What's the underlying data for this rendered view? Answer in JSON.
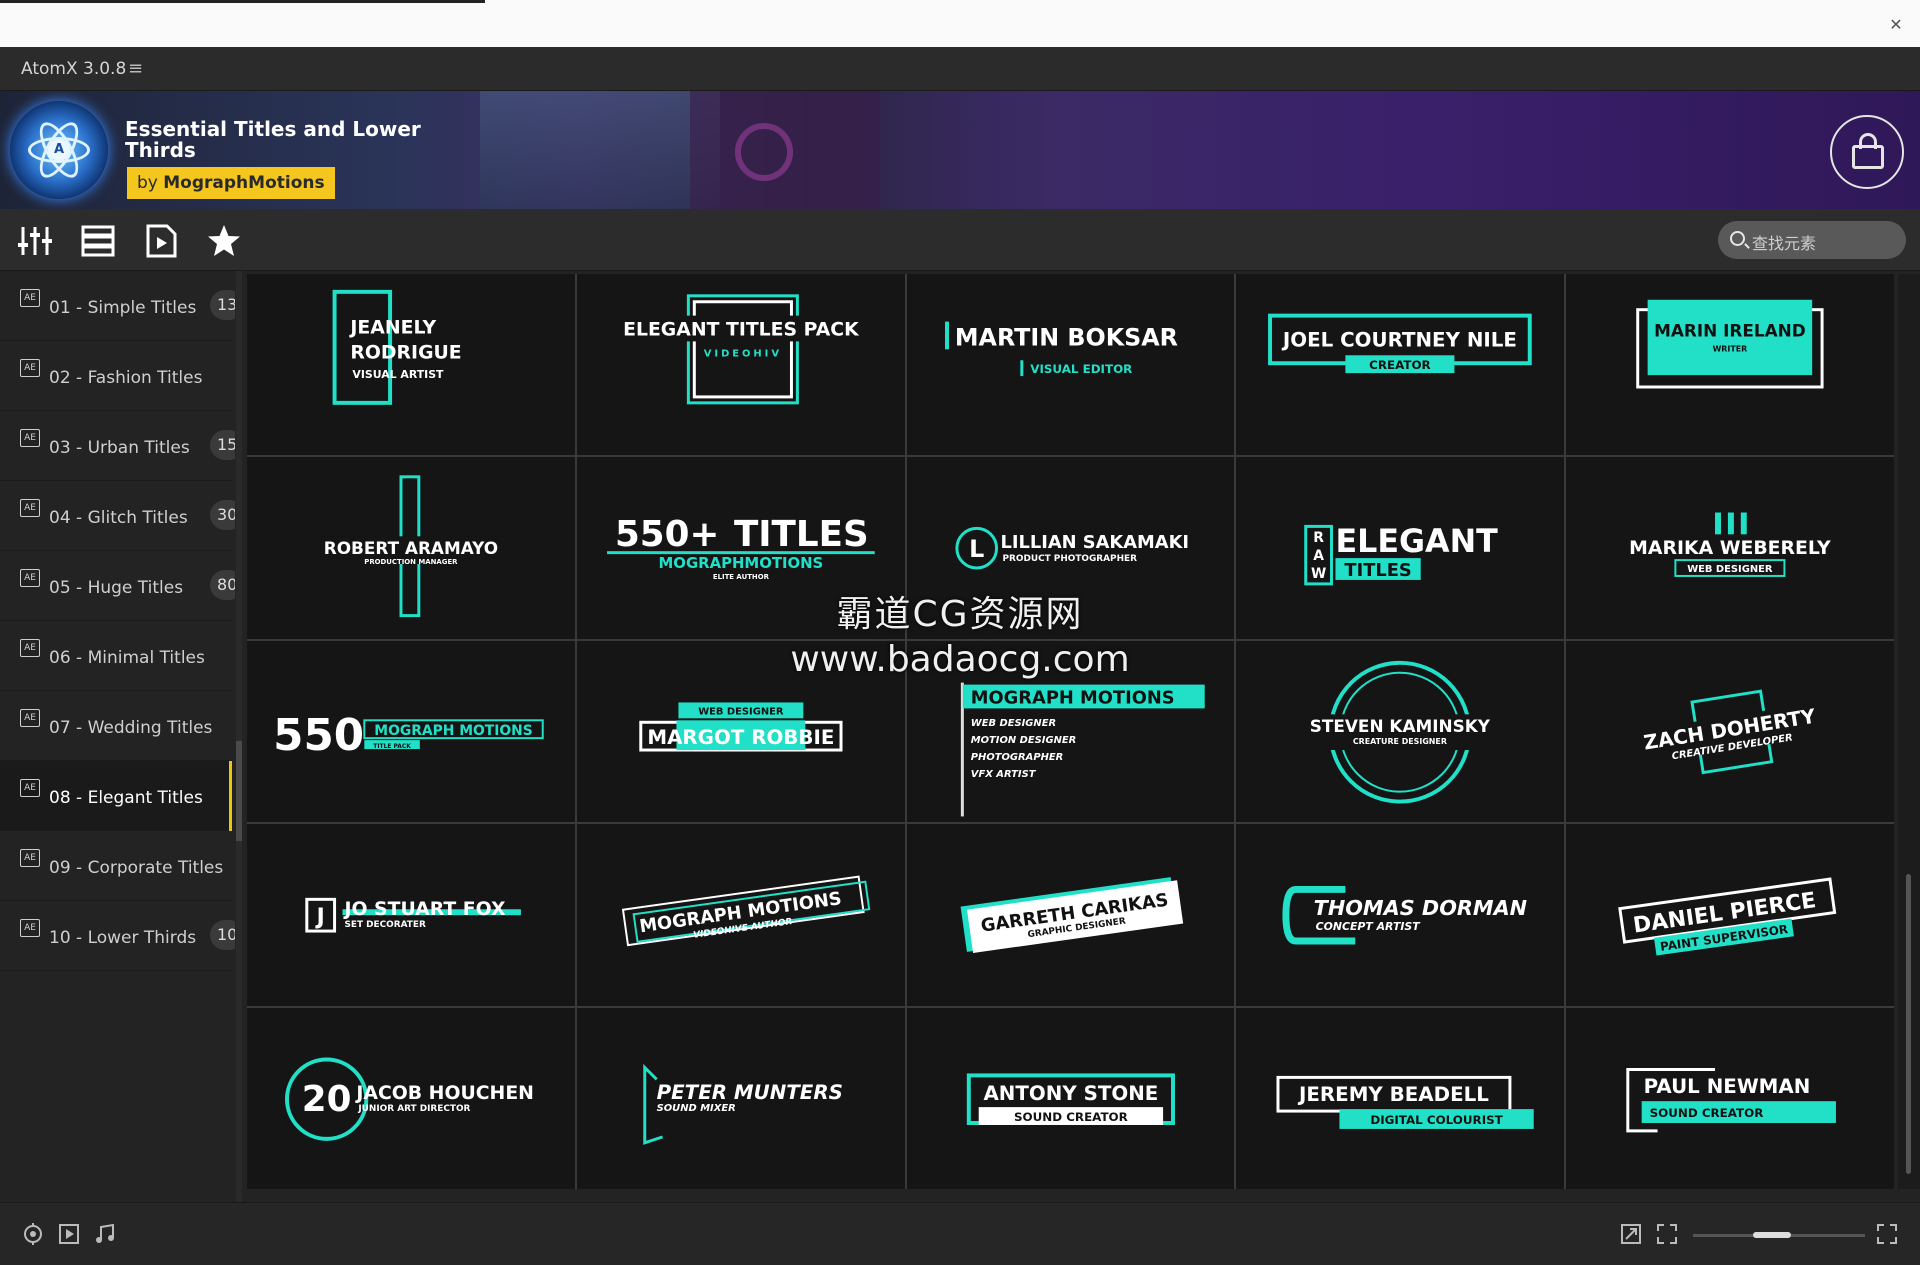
{
  "window": {
    "close_glyph": "✕"
  },
  "app": {
    "title": "AtomX 3.0.8",
    "menu_glyph": "≡"
  },
  "banner": {
    "pack_title": "Essential Titles and Lower Thirds",
    "by_prefix": "by",
    "author": "MographMotions",
    "logo_letter": "A"
  },
  "toolbar": {
    "icons": [
      "mixer-icon",
      "list-icon",
      "file-play-icon",
      "star-icon"
    ],
    "search_placeholder": "查找元素"
  },
  "sidebar": {
    "items": [
      {
        "label": "01 - Simple Titles",
        "count": "13",
        "badge": "AE"
      },
      {
        "label": "02 - Fashion Titles",
        "count": "",
        "badge": "AE"
      },
      {
        "label": "03 - Urban Titles",
        "count": "15",
        "badge": "AE"
      },
      {
        "label": "04 - Glitch Titles",
        "count": "30",
        "badge": "AE"
      },
      {
        "label": "05 - Huge Titles",
        "count": "80",
        "badge": "AE"
      },
      {
        "label": "06 - Minimal Titles",
        "count": "",
        "badge": "AE"
      },
      {
        "label": "07 - Wedding Titles",
        "count": "",
        "badge": "AE"
      },
      {
        "label": "08 - Elegant Titles",
        "count": "",
        "badge": "AE",
        "active": true
      },
      {
        "label": "09 - Corporate Titles",
        "count": "",
        "badge": "AE"
      },
      {
        "label": "10 - Lower Thirds",
        "count": "10",
        "badge": "AE"
      }
    ]
  },
  "accent": "#22e0c8",
  "tiles": [
    {
      "l1": "JEANELY",
      "l2": "RODRIGUE",
      "l3": "VISUAL ARTIST"
    },
    {
      "l1": "ELEGANT TITLES PACK",
      "l2": "VIDEOHIV"
    },
    {
      "l1": "MARTIN BOKSAR",
      "l2": "VISUAL EDITOR"
    },
    {
      "l1": "JOEL COURTNEY NILE",
      "l2": "CREATOR"
    },
    {
      "l1": "MARIN IRELAND",
      "l2": "WRITER"
    },
    {
      "l1": "ROBERT ARAMAYO",
      "l2": "PRODUCTION MANAGER"
    },
    {
      "l1": "550+",
      "l2": "TITLES",
      "l3": "MOGRAPHMOTIONS",
      "l4": "ELITE AUTHOR"
    },
    {
      "l1": "L",
      "l2": "LILLIAN SAKAMAKI",
      "l3": "PRODUCT PHOTOGRAPHER"
    },
    {
      "l1": "R",
      "l2": "A",
      "l3": "W",
      "l4": "ELEGANT",
      "l5": "TITLES"
    },
    {
      "l1": "MARIKA WEBERELY",
      "l2": "WEB DESIGNER"
    },
    {
      "l1": "550",
      "l2": "MOGRAPH MOTIONS",
      "l3": "TITLE PACK"
    },
    {
      "l1": "WEB DESIGNER",
      "l2": "MARGOT ROBBIE"
    },
    {
      "l1": "MOGRAPH MOTIONS",
      "l2": "WEB DESIGNER",
      "l3": "MOTION DESIGNER",
      "l4": "PHOTOGRAPHER",
      "l5": "VFX ARTIST"
    },
    {
      "l1": "STEVEN KAMINSKY",
      "l2": "CREATURE DESIGNER"
    },
    {
      "l1": "ZACH DOHERTY",
      "l2": "CREATIVE DEVELOPER"
    },
    {
      "l1": "J",
      "l2": "JO STUART FOX",
      "l3": "SET DECORATER"
    },
    {
      "l1": "MOGRAPH MOTIONS",
      "l2": "VIDEOHIVE AUTHOR"
    },
    {
      "l1": "GARRETH CARIKAS",
      "l2": "GRAPHIC DESIGNER"
    },
    {
      "l1": "THOMAS DORMAN",
      "l2": "CONCEPT ARTIST"
    },
    {
      "l1": "DANIEL PIERCE",
      "l2": "PAINT SUPERVISOR"
    },
    {
      "l1": "20",
      "l2": "JACOB HOUCHEN",
      "l3": "JUNIOR ART DIRECTOR"
    },
    {
      "l1": "PETER MUNTERS",
      "l2": "SOUND MIXER"
    },
    {
      "l1": "ANTONY STONE",
      "l2": "SOUND CREATOR"
    },
    {
      "l1": "JEREMY BEADELL",
      "l2": "DIGITAL COLOURIST"
    },
    {
      "l1": "PAUL NEWMAN",
      "l2": "SOUND CREATOR"
    }
  ],
  "watermark": {
    "line1": "霸道CG资源网",
    "line2": "www.badaocg.com"
  },
  "footer": {
    "icons": [
      "target-icon",
      "play-box-icon",
      "music-note-icon",
      "resize-icon",
      "fullscreen-corners-icon",
      "expand-icon"
    ],
    "zoom": 0.45
  }
}
